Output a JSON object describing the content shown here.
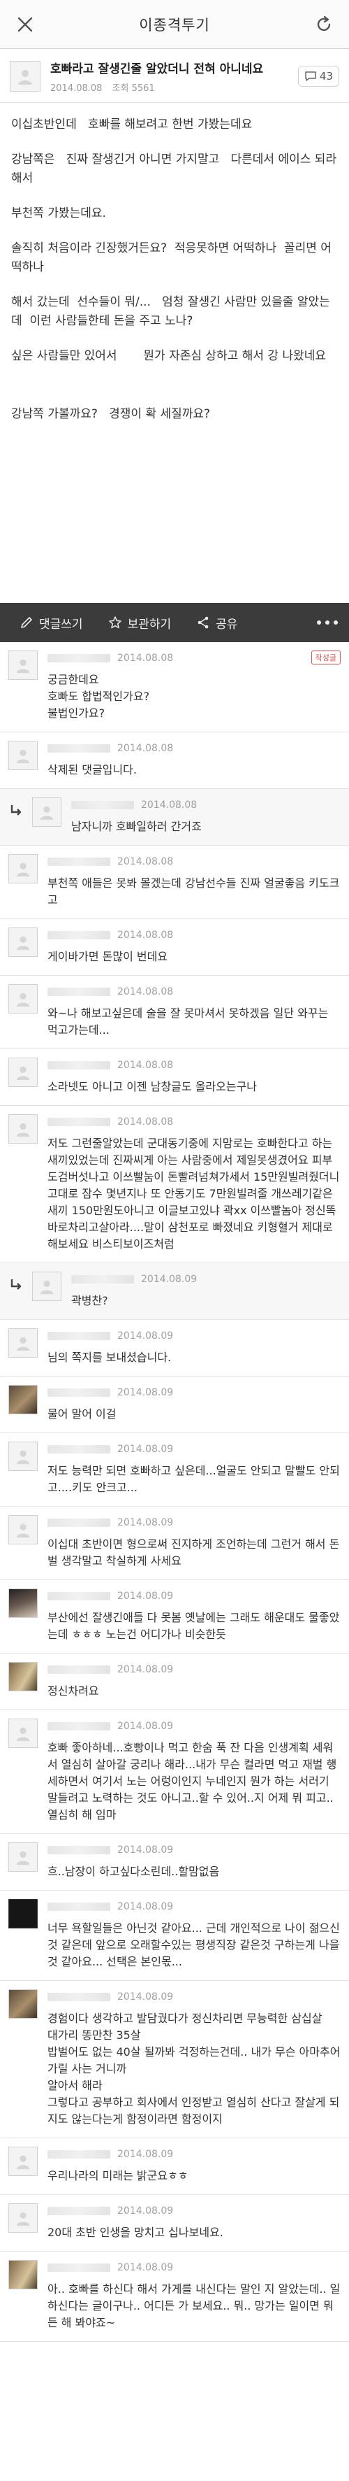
{
  "header": {
    "title": "이종격투기"
  },
  "post": {
    "title": "호빠라고 잘생긴줄 알았더니 전혀 아니네요",
    "date": "2014.08.08",
    "views": "조회 5561",
    "comment_count": "43",
    "paragraphs": [
      "이십초반인데   호빠를 해보려고 한번 가봤는데요",
      "강남쪽은   진짜 잘생긴거 아니면 가지말고   다른데서 에이스 되라해서",
      "부천쪽 가봤는데요.",
      "솔직히 처음이라 긴장했거든요?  적응못하면 어떡하나  꼴리면 어떡하나",
      "해서 갔는데  선수들이 뭐/...   엄청 잘생긴 사람만 있을줄 알았는데  이런 사람들한테 돈을 주고 노나?",
      "싶은 사람들만 있어서       뭔가 자존심 상하고 해서 강 나왔네요",
      "강남쪽 가볼까요?   경쟁이 확 세질까요?"
    ]
  },
  "actions": {
    "comment": "댓글쓰기",
    "save": "보관하기",
    "share": "공유"
  },
  "comments": [
    {
      "date": "2014.08.08",
      "text": "궁금한데요\n호빠도 합법적인가요?\n불법인가요?",
      "reply": false,
      "badge": "작성글",
      "avatar": "default"
    },
    {
      "date": "2014.08.08",
      "text": "삭제된 댓글입니다.",
      "reply": false,
      "badge": "",
      "avatar": "default"
    },
    {
      "date": "2014.08.08",
      "text": "남자니까 호빠일하러 간거죠",
      "reply": true,
      "badge": "",
      "avatar": "default"
    },
    {
      "date": "2014.08.08",
      "text": "부천쪽 애들은 못봐 몰겠는데 강남선수들 진짜 얼굴좋음 키도크고",
      "reply": false,
      "badge": "",
      "avatar": "default"
    },
    {
      "date": "2014.08.08",
      "text": "게이바가면 돈많이 번데요",
      "reply": false,
      "badge": "",
      "avatar": "default"
    },
    {
      "date": "2014.08.08",
      "text": "와~나 해보고싶은데 술을 잘 못마셔서 못하겠음 일단 와꾸는 먹고가는데...",
      "reply": false,
      "badge": "",
      "avatar": "default"
    },
    {
      "date": "2014.08.08",
      "text": "소라넷도 아니고 이젠 남창글도 올라오는구나",
      "reply": false,
      "badge": "",
      "avatar": "default"
    },
    {
      "date": "2014.08.08",
      "text": "저도 그런줄알았는데 군대동기중에 지맘로는 호빠한다고 하는새끼있었는데 진짜씨게 아는 사람중에서 제일못생겼어요 피부도검버섯나고 이쓰빨눔이 돈빨려넘쳐가세서 15만원빌려줬더니 고대로 잠수 몇년지나 또 안동기도 7만원빌려줄 개쓰레기같은새끼 150만원도아니고 이글보고있냐 곽xx 이쓰빨놈아 정신똑바로차리고살아라....말이 삼천포로 빠졌네요 키형혈거 제대로해보세요 비스티보이즈처럼",
      "reply": false,
      "badge": "",
      "avatar": "default"
    },
    {
      "date": "2014.08.09",
      "text": "곽병찬?",
      "reply": true,
      "badge": "",
      "avatar": "default"
    },
    {
      "date": "2014.08.09",
      "text": "님의 쪽지를 보내셨습니다.",
      "reply": false,
      "badge": "",
      "avatar": "default",
      "blur_prefix": true
    },
    {
      "date": "2014.08.09",
      "text": "물어 말어 이걸",
      "reply": false,
      "badge": "",
      "avatar": "photo"
    },
    {
      "date": "2014.08.09",
      "text": "저도 능력만 되면 호빠하고 싶은데...얼굴도 안되고 말빨도 안되고....키도 안크고...",
      "reply": false,
      "badge": "",
      "avatar": "default"
    },
    {
      "date": "2014.08.09",
      "text": "이십대 초반이면 형으로써 진지하게 조언하는데 그런거 해서 돈 벌 생각말고 착실하게 사세요",
      "reply": false,
      "badge": "",
      "avatar": "default"
    },
    {
      "date": "2014.08.09",
      "text": "부산에선 잘생긴애들 다 못봄 옛날에는 그래도 해운대도 물좋았는데 ㅎㅎㅎ 노는건 어디가나 비슷한듯",
      "reply": false,
      "badge": "",
      "avatar": "photo2"
    },
    {
      "date": "2014.08.09",
      "text": "정신차려요",
      "reply": false,
      "badge": "",
      "avatar": "photo3"
    },
    {
      "date": "2014.08.09",
      "text": "호빠 좋아하네...호빵이나 먹고 한숨 푹 잔 다음 인생계획 세워서 열심히 살아갈 궁리나 해라...내가 무슨 컬라면 먹고 재벌 행세하면서 여기서 노는 어렁이인지 누네인지 뭔가 하는 서러기 말들려고 노력하는 것도 아니고..할 수 있어..지 어제 뭐 피고..열심히 해 임마",
      "reply": false,
      "badge": "",
      "avatar": "default"
    },
    {
      "date": "2014.08.09",
      "text": "흐..남장이 하고싶다소린데..할맘없음",
      "reply": false,
      "badge": "",
      "avatar": "default"
    },
    {
      "date": "2014.08.09",
      "text": "너무 욕할일들은 아닌것 같아요... 근데 개인적으로 나이 젊으신것 같은데 앞으로 오래할수있는 평생직장 같은것 구하는게 나을것 같아요... 선택은 본인몫...",
      "reply": false,
      "badge": "",
      "avatar": "dark"
    },
    {
      "date": "2014.08.09",
      "text": "경험이다 생각하고 발담궜다가 정신차리면 무능력한 삼십살\n대가리 똥만찬 35살\n밥벌어도 없는 40살 될까봐 걱정하는건데.. 내가 무슨 아마추어 가릴 사는 거니까\n알아서 해라\n그렇다고 공부하고 회사에서 인정받고 열심히 산다고 잘살게 되지도 않는다는게 함정이라면 함정이지",
      "reply": false,
      "badge": "",
      "avatar": "photo"
    },
    {
      "date": "2014.08.09",
      "text": "우리나라의 미래는 밝군요ㅎㅎ",
      "reply": false,
      "badge": "",
      "avatar": "default"
    },
    {
      "date": "2014.08.09",
      "text": "20대 초반 인생을 망치고 십나보네요.",
      "reply": false,
      "badge": "",
      "avatar": "default"
    },
    {
      "date": "2014.08.09",
      "text": "아.. 호빠를 하신다 해서 가게를 내신다는 말인 지 알았는데.. 일하신다는 글이구나.. 어디든 가 보세요.. 뭐.. 망가는 일이면 뭐든 해 봐야죠~",
      "reply": false,
      "badge": "",
      "avatar": "photo3"
    }
  ]
}
